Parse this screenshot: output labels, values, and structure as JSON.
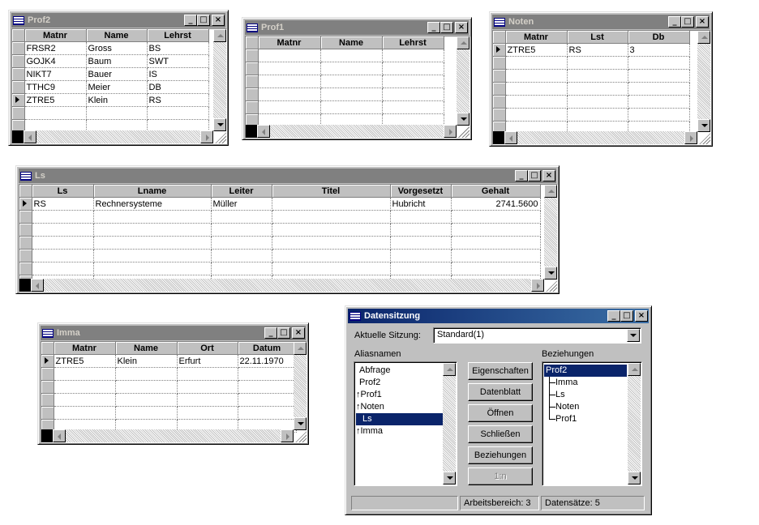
{
  "windows": {
    "prof2": {
      "title": "Prof2",
      "columns": [
        "Matnr",
        "Name",
        "Lehrst"
      ],
      "rows": [
        [
          "FRSR2",
          "Gross",
          "BS"
        ],
        [
          "GOJK4",
          "Baum",
          "SWT"
        ],
        [
          "NIKT7",
          "Bauer",
          "IS"
        ],
        [
          "TTHC9",
          "Meier",
          "DB"
        ],
        [
          "ZTRE5",
          "Klein",
          "RS"
        ]
      ]
    },
    "prof1": {
      "title": "Prof1",
      "columns": [
        "Matnr",
        "Name",
        "Lehrst"
      ],
      "rows": []
    },
    "noten": {
      "title": "Noten",
      "columns": [
        "Matnr",
        "Lst",
        "Db"
      ],
      "rows": [
        [
          "ZTRE5",
          "RS",
          "3"
        ]
      ]
    },
    "ls": {
      "title": "Ls",
      "columns": [
        "Ls",
        "Lname",
        "Leiter",
        "Titel",
        "Vorgesetzt",
        "Gehalt"
      ],
      "rows": [
        [
          "RS",
          "Rechnersysteme",
          "Müller",
          "",
          "Hubricht",
          "2741.5600"
        ]
      ]
    },
    "imma": {
      "title": "Imma",
      "columns": [
        "Matnr",
        "Name",
        "Ort",
        "Datum"
      ],
      "rows": [
        [
          "ZTRE5",
          "Klein",
          "Erfurt",
          "22.11.1970"
        ]
      ]
    }
  },
  "datensitzung": {
    "title": "Datensitzung",
    "session_label": "Aktuelle Sitzung:",
    "session_value": "Standard(1)",
    "aliases_label": "Aliasnamen",
    "relations_label": "Beziehungen",
    "aliases": [
      {
        "name": "Abfrage",
        "arrow": false,
        "selected": false
      },
      {
        "name": "Prof2",
        "arrow": false,
        "selected": false
      },
      {
        "name": "Prof1",
        "arrow": true,
        "selected": false
      },
      {
        "name": "Noten",
        "arrow": true,
        "selected": false
      },
      {
        "name": "Ls",
        "arrow": false,
        "selected": true
      },
      {
        "name": "Imma",
        "arrow": true,
        "selected": false
      }
    ],
    "relations_root": "Prof2",
    "relations_children": [
      "Imma",
      "Ls",
      "Noten",
      "Prof1"
    ],
    "buttons": {
      "properties": "Eigenschaften",
      "datasheet": "Datenblatt",
      "open": "Öffnen",
      "close": "Schließen",
      "relations": "Beziehungen",
      "onen": "1:n"
    },
    "status": {
      "empty": "",
      "workspace": "Arbeitsbereich: 3",
      "records": "Datensätze: 5"
    }
  },
  "window_buttons": {
    "minimize": "_",
    "maximize": "□",
    "close": "×"
  },
  "arrow_glyph": "↑"
}
